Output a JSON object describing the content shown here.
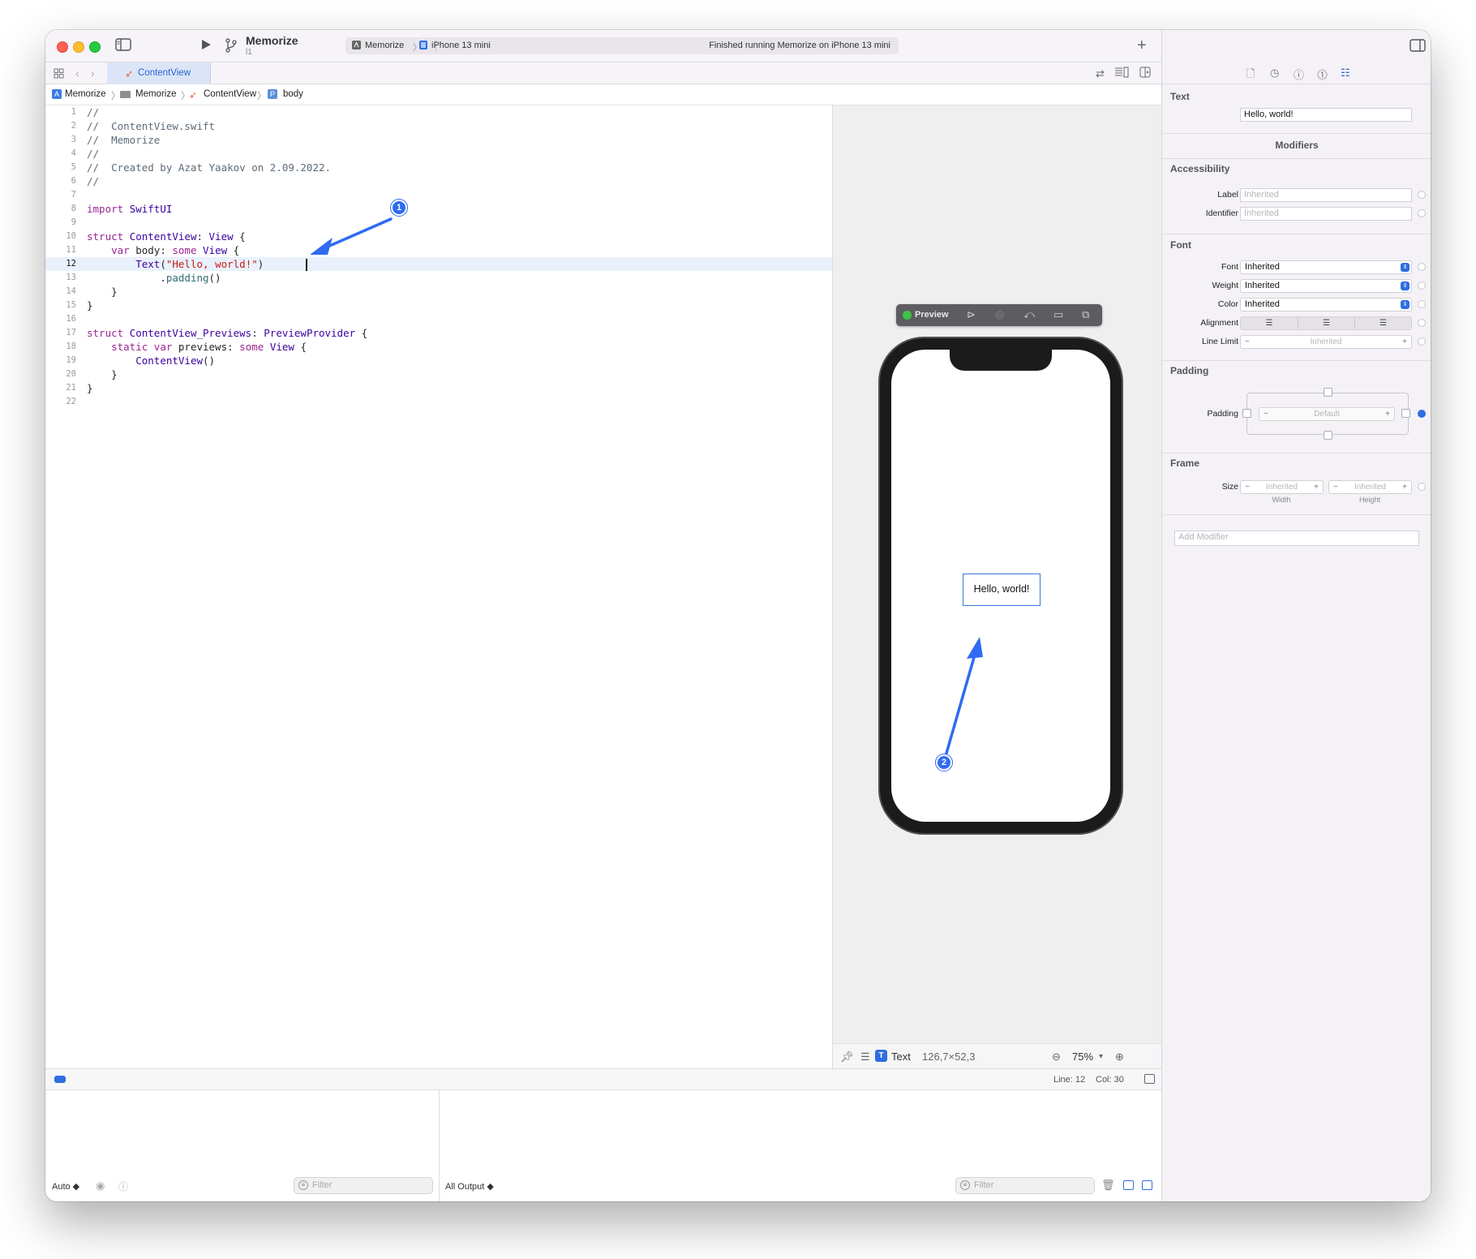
{
  "toolbar": {
    "scheme_title": "Memorize",
    "scheme_sub": "l1",
    "destination_project": "Memorize",
    "destination_device": "iPhone 13 mini",
    "status_message": "Finished running Memorize on iPhone 13 mini",
    "add_label": "+"
  },
  "tabs": [
    {
      "label": "ContentView"
    }
  ],
  "breadcrumb": [
    "Memorize",
    "Memorize",
    "ContentView",
    "body"
  ],
  "code_lines": [
    {
      "n": "1",
      "text": "//"
    },
    {
      "n": "2",
      "text": "//  ContentView.swift"
    },
    {
      "n": "3",
      "text": "//  Memorize"
    },
    {
      "n": "4",
      "text": "//"
    },
    {
      "n": "5",
      "text": "//  Created by Azat Yaakov on 2.09.2022."
    },
    {
      "n": "6",
      "text": "//"
    },
    {
      "n": "7",
      "text": ""
    },
    {
      "n": "8",
      "text": "import SwiftUI"
    },
    {
      "n": "9",
      "text": ""
    },
    {
      "n": "10",
      "text": "struct ContentView: View {"
    },
    {
      "n": "11",
      "text": "    var body: some View {"
    },
    {
      "n": "12",
      "text": "        Text(\"Hello, world!\")"
    },
    {
      "n": "13",
      "text": "            .padding()"
    },
    {
      "n": "14",
      "text": "    }"
    },
    {
      "n": "15",
      "text": "}"
    },
    {
      "n": "16",
      "text": ""
    },
    {
      "n": "17",
      "text": "struct ContentView_Previews: PreviewProvider {"
    },
    {
      "n": "18",
      "text": "    static var previews: some View {"
    },
    {
      "n": "19",
      "text": "        ContentView()"
    },
    {
      "n": "20",
      "text": "    }"
    },
    {
      "n": "21",
      "text": "}"
    },
    {
      "n": "22",
      "text": ""
    }
  ],
  "current_line": "12",
  "preview": {
    "label": "Preview",
    "hello_text": "Hello, world!",
    "selection_type": "Text",
    "selection_size": "126,7×52,3",
    "zoom": "75%"
  },
  "status_bar": {
    "line": "Line: 12",
    "col": "Col: 30"
  },
  "debug": {
    "auto_label": "Auto ◆",
    "filter_placeholder": "Filter",
    "output_label": "All Output ◆"
  },
  "inspector": {
    "text_section": "Text",
    "text_value": "Hello, world!",
    "modifiers_title": "Modifiers",
    "accessibility_section": "Accessibility",
    "label_label": "Label",
    "label_placeholder": "Inherited",
    "identifier_label": "Identifier",
    "identifier_placeholder": "Inherited",
    "font_section": "Font",
    "font_label": "Font",
    "font_value": "Inherited",
    "weight_label": "Weight",
    "weight_value": "Inherited",
    "color_label": "Color",
    "color_value": "Inherited",
    "alignment_label": "Alignment",
    "line_limit_label": "Line Limit",
    "line_limit_value": "Inherited",
    "padding_section": "Padding",
    "padding_label": "Padding",
    "padding_value": "Default",
    "frame_section": "Frame",
    "size_label": "Size",
    "width_value": "Inherited",
    "height_value": "Inherited",
    "width_caption": "Width",
    "height_caption": "Height",
    "add_modifier_placeholder": "Add Modifier"
  },
  "annotations": [
    {
      "label": "1"
    },
    {
      "label": "2"
    }
  ],
  "colors": {
    "accent": "#2a63d6",
    "annotation": "#2f6bf2",
    "keyword": "#9b2393",
    "string": "#c41a16"
  }
}
